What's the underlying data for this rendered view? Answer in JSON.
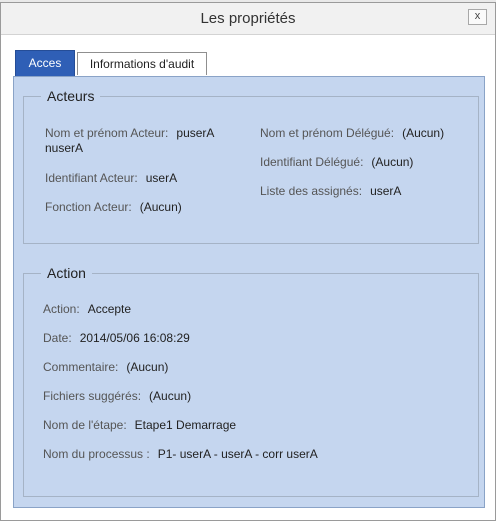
{
  "window": {
    "title": "Les propriétés",
    "close_label": "x"
  },
  "tabs": [
    {
      "label": "Acces",
      "active": true
    },
    {
      "label": "Informations d'audit",
      "active": false
    }
  ],
  "acteurs": {
    "legend": "Acteurs",
    "nom_acteur": {
      "label": "Nom et prénom Acteur:",
      "value": "puserA nuserA"
    },
    "identifiant_acteur": {
      "label": "Identifiant Acteur:",
      "value": "userA"
    },
    "fonction_acteur": {
      "label": "Fonction Acteur:",
      "value": "(Aucun)"
    },
    "nom_delegue": {
      "label": "Nom et prénom Délégué:",
      "value": "(Aucun)"
    },
    "identifiant_delegue": {
      "label": "Identifiant Délégué:",
      "value": "(Aucun)"
    },
    "liste_assignes": {
      "label": "Liste des assignés:",
      "value": "userA"
    }
  },
  "action": {
    "legend": "Action",
    "action": {
      "label": "Action:",
      "value": "Accepte"
    },
    "date": {
      "label": "Date:",
      "value": "2014/05/06 16:08:29"
    },
    "commentaire": {
      "label": "Commentaire:",
      "value": "(Aucun)"
    },
    "fichiers": {
      "label": "Fichiers suggérés:",
      "value": "(Aucun)"
    },
    "etape": {
      "label": "Nom de l'étape:",
      "value": "Etape1 Demarrage"
    },
    "processus": {
      "label": "Nom du processus :",
      "value": "P1- userA - userA - corr userA"
    }
  },
  "colors": {
    "panel_bg": "#c5d6ef",
    "active_tab": "#2f5fb6"
  }
}
